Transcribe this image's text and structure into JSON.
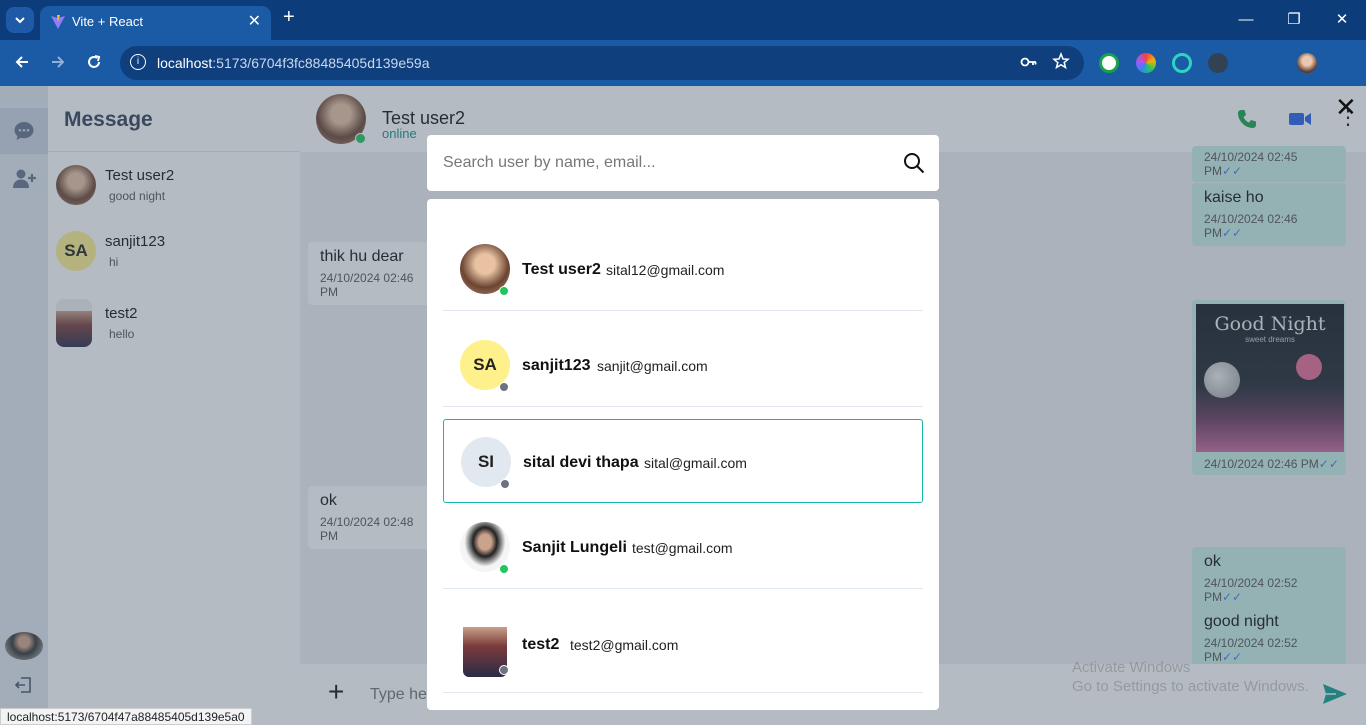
{
  "browser": {
    "tab_title": "Vite + React",
    "new_tab_symbol": "+",
    "tab_close_symbol": "✕",
    "url_host": "localhost",
    "url_rest": ":5173/6704f3fc88485405d139e59a",
    "status_url": "localhost:5173/6704f47a88485405d139e5a0",
    "window_controls": [
      "—",
      "❐",
      "✕"
    ]
  },
  "sidebar": {
    "title": "Message",
    "conversations": [
      {
        "name": "Test user2",
        "last_message": "good night"
      },
      {
        "name": "sanjit123",
        "initials": "SA",
        "last_message": "hi"
      },
      {
        "name": "test2",
        "last_message": "hello"
      }
    ]
  },
  "chat": {
    "contact_name": "Test user2",
    "contact_status": "online",
    "messages_left": [
      {
        "text": "thik hu dear",
        "time": "24/10/2024 02:46 PM"
      },
      {
        "text": "ok",
        "time": "24/10/2024 02:48 PM"
      }
    ],
    "messages_right": [
      {
        "text": "",
        "time": "24/10/2024 02:45 PM"
      },
      {
        "text": "kaise ho",
        "time": "24/10/2024 02:46 PM"
      },
      {
        "text": "",
        "time": "24/10/2024 02:46 PM",
        "image_title": "Good Night",
        "image_subtitle": "sweet dreams"
      },
      {
        "text": "ok",
        "time": "24/10/2024 02:52 PM"
      },
      {
        "text": "good night",
        "time": "24/10/2024 02:52 PM"
      }
    ],
    "checkmark": "✓✓",
    "composer_placeholder": "Type he",
    "plus_symbol": "+"
  },
  "search_modal": {
    "placeholder": "Search user by name, email...",
    "close_symbol": "✕",
    "results": [
      {
        "name": "Test user2",
        "email": "sital12@gmail.com",
        "online": true
      },
      {
        "name": "sanjit123",
        "email": "sanjit@gmail.com",
        "initials": "SA",
        "online": false
      },
      {
        "name": "sital devi thapa",
        "email": "sital@gmail.com",
        "initials": "SI",
        "online": false,
        "selected": true
      },
      {
        "name": "Sanjit Lungeli",
        "email": "test@gmail.com",
        "online": true
      },
      {
        "name": "test2",
        "email": "test2@gmail.com",
        "online": false
      }
    ]
  },
  "watermark": {
    "line1": "Activate Windows",
    "line2": "Go to Settings to activate Windows."
  },
  "colors": {
    "chrome_dark": "#0c3c7a",
    "chrome_toolbar": "#1b5aa5",
    "accent_teal": "#14b8a6",
    "online_green": "#22c55e",
    "offline_gray": "#6b7280",
    "avatar_yellow": "#fef08a",
    "avatar_slate": "#e2e8f0",
    "call_green": "#16a34a",
    "video_blue": "#2563eb",
    "send_teal": "#0f9d8f"
  }
}
